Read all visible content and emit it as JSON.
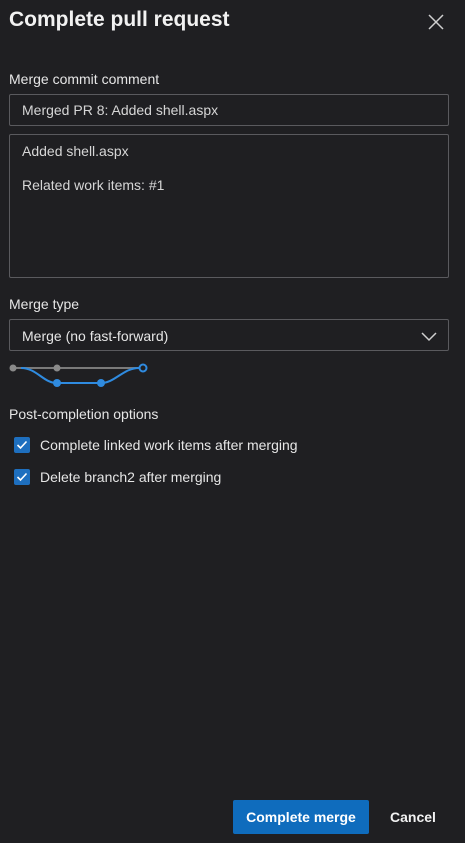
{
  "dialog": {
    "title": "Complete pull request"
  },
  "merge_commit": {
    "label": "Merge commit comment",
    "title_value": "Merged PR 8: Added shell.aspx",
    "description_lines": [
      "Added shell.aspx",
      "",
      "Related work items: #1"
    ]
  },
  "merge_type": {
    "label": "Merge type",
    "selected": "Merge (no fast-forward)"
  },
  "post_completion": {
    "label": "Post-completion options",
    "options": [
      {
        "label": "Complete linked work items after merging",
        "checked": true
      },
      {
        "label": "Delete branch2 after merging",
        "checked": true
      }
    ]
  },
  "actions": {
    "complete_label": "Complete merge",
    "cancel_label": "Cancel"
  },
  "colors": {
    "background": "#1f1f22",
    "accent": "#0f6cbd",
    "checkbox": "#1e6fbf",
    "diagram_branch": "#2f8be0",
    "diagram_main": "#8a8a8a"
  }
}
